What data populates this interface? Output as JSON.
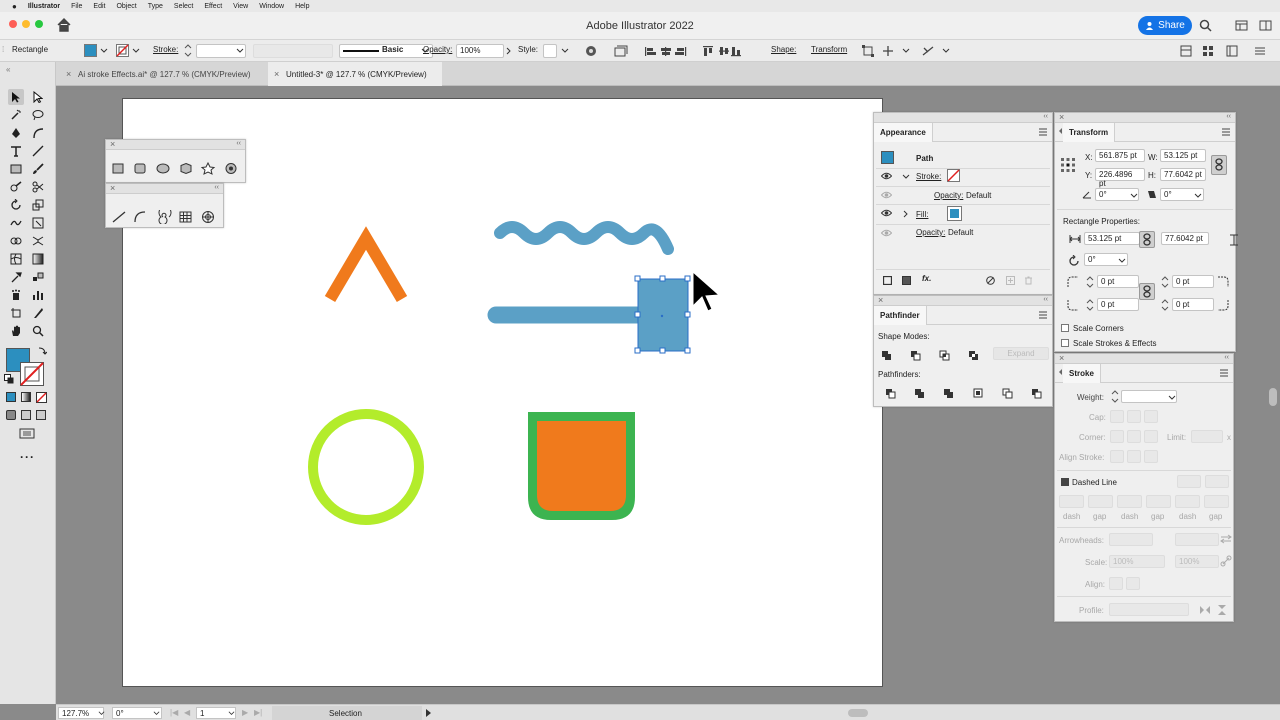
{
  "menubar": {
    "apple": "",
    "app": "Illustrator",
    "items": [
      "File",
      "Edit",
      "Object",
      "Type",
      "Select",
      "Effect",
      "View",
      "Window",
      "Help"
    ]
  },
  "appbar": {
    "title": "Adobe Illustrator 2022",
    "share_label": "Share"
  },
  "controlbar": {
    "selection_type": "Rectangle",
    "stroke_label": "Stroke:",
    "brush_label": "Basic",
    "opacity_label": "Opacity:",
    "opacity_value": "100%",
    "style_label": "Style:",
    "shape_label": "Shape:",
    "transform_label": "Transform"
  },
  "tabs": [
    {
      "label": "Ai stroke Effects.ai* @ 127.7 % (CMYK/Preview)",
      "close": "×"
    },
    {
      "label": "Untitled-3* @ 127.7 % (CMYK/Preview)",
      "close": "×"
    }
  ],
  "canvas": {
    "colors": {
      "orange": "#f07a1c",
      "blue": "#5ba0c6",
      "lime": "#b3ec2b",
      "green": "#3cb450",
      "selection": "#2a6ec7"
    }
  },
  "appearance": {
    "tab": "Appearance",
    "object": "Path",
    "stroke_label": "Stroke:",
    "opacity1_label": "Opacity:",
    "opacity1_value": "Default",
    "fill_label": "Fill:",
    "opacity2_label": "Opacity:",
    "opacity2_value": "Default",
    "fx": "fx."
  },
  "pathfinder": {
    "tab": "Pathfinder",
    "shape_modes": "Shape Modes:",
    "expand": "Expand",
    "pathfinders": "Pathfinders:"
  },
  "transform": {
    "tab": "Transform",
    "x_label": "X:",
    "x_value": "561.875 pt",
    "y_label": "Y:",
    "y_value": "226.4896 pt",
    "w_label": "W:",
    "w_value": "53.125 pt",
    "h_label": "H:",
    "h_value": "77.6042 pt",
    "angle_value": "0°",
    "shear_value": "0°",
    "rect_props": "Rectangle Properties:",
    "rect_w": "53.125 pt",
    "rect_h": "77.6042 pt",
    "rect_angle": "0°",
    "radius_tl": "0 pt",
    "radius_tr": "0 pt",
    "radius_bl": "0 pt",
    "radius_br": "0 pt",
    "scale_corners": "Scale Corners",
    "scale_strokes": "Scale Strokes & Effects"
  },
  "stroke_panel": {
    "tab": "Stroke",
    "weight_label": "Weight:",
    "cap_label": "Cap:",
    "corner_label": "Corner:",
    "limit_label": "Limit:",
    "limit_x": "x",
    "align_label": "Align Stroke:",
    "dashed_label": "Dashed Line",
    "dash_labels": [
      "dash",
      "gap",
      "dash",
      "gap",
      "dash",
      "gap"
    ],
    "arrowheads_label": "Arrowheads:",
    "scale_label": "Scale:",
    "scale_a": "100%",
    "scale_b": "100%",
    "align2_label": "Align:",
    "profile_label": "Profile:"
  },
  "statusbar": {
    "zoom": "127.7%",
    "rotation": "0°",
    "artboard": "1",
    "tool": "Selection"
  }
}
